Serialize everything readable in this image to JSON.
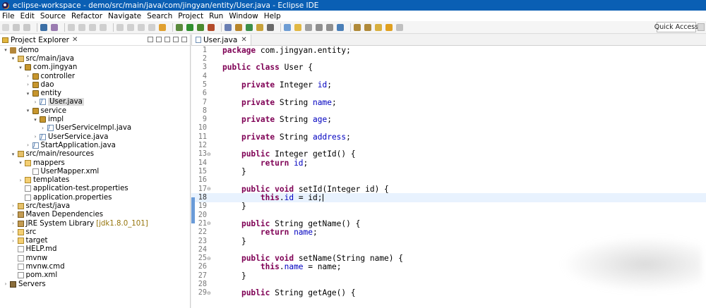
{
  "window": {
    "title": "eclipse-workspace - demo/src/main/java/com/jingyan/entity/User.java - Eclipse IDE"
  },
  "menu": [
    "File",
    "Edit",
    "Source",
    "Refactor",
    "Navigate",
    "Search",
    "Project",
    "Run",
    "Window",
    "Help"
  ],
  "toolbar": {
    "quick_access": "Quick Access",
    "buttons": [
      {
        "icon": "new-icon",
        "color": "#d7d7d7"
      },
      {
        "icon": "save-icon",
        "color": "#c9c9c9"
      },
      {
        "icon": "save-all-icon",
        "color": "#c9c9c9"
      },
      {
        "icon": "terminal-icon",
        "color": "#3b6ea5"
      },
      {
        "icon": "skip-icon",
        "color": "#9a7bb0"
      },
      {
        "icon": "resume-icon",
        "color": "#cfcfcf"
      },
      {
        "icon": "suspend-icon",
        "color": "#cfcfcf"
      },
      {
        "icon": "terminate-icon",
        "color": "#cfcfcf"
      },
      {
        "icon": "disconnect-icon",
        "color": "#cfcfcf"
      },
      {
        "icon": "step-into-icon",
        "color": "#d0d0d0"
      },
      {
        "icon": "step-over-icon",
        "color": "#d0d0d0"
      },
      {
        "icon": "step-return-icon",
        "color": "#d0d0d0"
      },
      {
        "icon": "drop-frame-icon",
        "color": "#d0d0d0"
      },
      {
        "icon": "use-step-filters-icon",
        "color": "#e0a030"
      },
      {
        "icon": "debug-icon",
        "color": "#5a8a3c"
      },
      {
        "icon": "run-icon",
        "color": "#2f8f2f"
      },
      {
        "icon": "coverage-icon",
        "color": "#4b8a2f"
      },
      {
        "icon": "external-tools-icon",
        "color": "#b34b2a"
      },
      {
        "icon": "new-java-project-icon",
        "color": "#6b7fb3"
      },
      {
        "icon": "new-package-icon",
        "color": "#b8862b"
      },
      {
        "icon": "new-class-icon",
        "color": "#3c8f4a"
      },
      {
        "icon": "open-type-icon",
        "color": "#c8a23a"
      },
      {
        "icon": "search-icon",
        "color": "#6a6a6a"
      },
      {
        "icon": "annotation-icon",
        "color": "#6e9dd4"
      },
      {
        "icon": "mark-occurrences-icon",
        "color": "#e1b844"
      },
      {
        "icon": "block-selection-icon",
        "color": "#a0a0a0"
      },
      {
        "icon": "show-whitespace-icon",
        "color": "#8f8f8f"
      },
      {
        "icon": "pilcrow-icon",
        "color": "#8f8f8f"
      },
      {
        "icon": "globe-icon",
        "color": "#4a7fb8"
      },
      {
        "icon": "next-annotation-icon",
        "color": "#b08a3a"
      },
      {
        "icon": "prev-annotation-icon",
        "color": "#b08a3a"
      },
      {
        "icon": "last-edit-icon",
        "color": "#d8b040"
      },
      {
        "icon": "back-icon",
        "color": "#e0a020"
      },
      {
        "icon": "forward-icon",
        "color": "#c0c0c0"
      }
    ]
  },
  "explorer": {
    "title": "Project Explorer",
    "close_glyph": "✕",
    "tree": [
      {
        "label": "demo",
        "depth": 0,
        "state": "expanded",
        "icon": "project-icon"
      },
      {
        "label": "src/main/java",
        "depth": 1,
        "state": "expanded",
        "icon": "source-folder-icon"
      },
      {
        "label": "com.jingyan",
        "depth": 2,
        "state": "expanded",
        "icon": "package-icon"
      },
      {
        "label": "controller",
        "depth": 3,
        "state": "collapsed",
        "icon": "package-icon"
      },
      {
        "label": "dao",
        "depth": 3,
        "state": "collapsed",
        "icon": "package-icon"
      },
      {
        "label": "entity",
        "depth": 3,
        "state": "expanded",
        "icon": "package-icon"
      },
      {
        "label": "User.java",
        "depth": 4,
        "state": "collapsed",
        "icon": "java-file-icon",
        "selected": true
      },
      {
        "label": "service",
        "depth": 3,
        "state": "expanded",
        "icon": "package-icon"
      },
      {
        "label": "impl",
        "depth": 4,
        "state": "expanded",
        "icon": "package-icon"
      },
      {
        "label": "UserServiceImpl.java",
        "depth": 5,
        "state": "collapsed",
        "icon": "java-file-icon"
      },
      {
        "label": "UserService.java",
        "depth": 4,
        "state": "collapsed",
        "icon": "java-file-icon"
      },
      {
        "label": "StartApplication.java",
        "depth": 3,
        "state": "collapsed",
        "icon": "java-file-icon"
      },
      {
        "label": "src/main/resources",
        "depth": 1,
        "state": "expanded",
        "icon": "source-folder-icon"
      },
      {
        "label": "mappers",
        "depth": 2,
        "state": "expanded",
        "icon": "folder-icon"
      },
      {
        "label": "UserMapper.xml",
        "depth": 3,
        "state": "none",
        "icon": "xml-file-icon"
      },
      {
        "label": "templates",
        "depth": 2,
        "state": "collapsed",
        "icon": "folder-icon"
      },
      {
        "label": "application-test.properties",
        "depth": 2,
        "state": "none",
        "icon": "properties-file-icon"
      },
      {
        "label": "application.properties",
        "depth": 2,
        "state": "none",
        "icon": "properties-file-icon"
      },
      {
        "label": "src/test/java",
        "depth": 1,
        "state": "collapsed",
        "icon": "source-folder-icon"
      },
      {
        "label": "Maven Dependencies",
        "depth": 1,
        "state": "collapsed",
        "icon": "library-icon"
      },
      {
        "label": "JRE System Library",
        "depth": 1,
        "state": "collapsed",
        "icon": "library-icon",
        "decoration": "[jdk1.8.0_101]"
      },
      {
        "label": "src",
        "depth": 1,
        "state": "collapsed",
        "icon": "folder-icon"
      },
      {
        "label": "target",
        "depth": 1,
        "state": "collapsed",
        "icon": "folder-icon"
      },
      {
        "label": "HELP.md",
        "depth": 1,
        "state": "none",
        "icon": "text-file-icon"
      },
      {
        "label": "mvnw",
        "depth": 1,
        "state": "none",
        "icon": "text-file-icon"
      },
      {
        "label": "mvnw.cmd",
        "depth": 1,
        "state": "none",
        "icon": "text-file-icon"
      },
      {
        "label": "pom.xml",
        "depth": 1,
        "state": "none",
        "icon": "xml-file-icon"
      },
      {
        "label": "Servers",
        "depth": 0,
        "state": "collapsed",
        "icon": "servers-icon"
      }
    ]
  },
  "editor": {
    "tab_label": "User.java",
    "close_glyph": "✕",
    "current_line": 18,
    "lines": [
      {
        "n": "1",
        "fold": "",
        "tokens": [
          {
            "t": "package",
            "k": "kw"
          },
          {
            "t": " com.jingyan.entity;"
          }
        ]
      },
      {
        "n": "2",
        "fold": "",
        "tokens": []
      },
      {
        "n": "3",
        "fold": "",
        "tokens": [
          {
            "t": "public",
            "k": "kw"
          },
          {
            "t": " "
          },
          {
            "t": "class",
            "k": "kw"
          },
          {
            "t": " User {"
          }
        ]
      },
      {
        "n": "4",
        "fold": "",
        "tokens": []
      },
      {
        "n": "5",
        "fold": "",
        "tokens": [
          {
            "t": "    "
          },
          {
            "t": "private",
            "k": "kw"
          },
          {
            "t": " Integer "
          },
          {
            "t": "id",
            "k": "fd"
          },
          {
            "t": ";"
          }
        ]
      },
      {
        "n": "6",
        "fold": "",
        "tokens": []
      },
      {
        "n": "7",
        "fold": "",
        "tokens": [
          {
            "t": "    "
          },
          {
            "t": "private",
            "k": "kw"
          },
          {
            "t": " String "
          },
          {
            "t": "name",
            "k": "fd"
          },
          {
            "t": ";"
          }
        ]
      },
      {
        "n": "8",
        "fold": "",
        "tokens": []
      },
      {
        "n": "9",
        "fold": "",
        "tokens": [
          {
            "t": "    "
          },
          {
            "t": "private",
            "k": "kw"
          },
          {
            "t": " String "
          },
          {
            "t": "age",
            "k": "fd"
          },
          {
            "t": ";"
          }
        ]
      },
      {
        "n": "10",
        "fold": "",
        "tokens": []
      },
      {
        "n": "11",
        "fold": "",
        "tokens": [
          {
            "t": "    "
          },
          {
            "t": "private",
            "k": "kw"
          },
          {
            "t": " String "
          },
          {
            "t": "address",
            "k": "fd"
          },
          {
            "t": ";"
          }
        ]
      },
      {
        "n": "12",
        "fold": "",
        "tokens": []
      },
      {
        "n": "13",
        "fold": "⊖",
        "tokens": [
          {
            "t": "    "
          },
          {
            "t": "public",
            "k": "kw"
          },
          {
            "t": " Integer getId() {"
          }
        ]
      },
      {
        "n": "14",
        "fold": "",
        "tokens": [
          {
            "t": "        "
          },
          {
            "t": "return",
            "k": "kw"
          },
          {
            "t": " "
          },
          {
            "t": "id",
            "k": "fd"
          },
          {
            "t": ";"
          }
        ]
      },
      {
        "n": "15",
        "fold": "",
        "tokens": [
          {
            "t": "    }"
          }
        ]
      },
      {
        "n": "16",
        "fold": "",
        "tokens": []
      },
      {
        "n": "17",
        "fold": "⊖",
        "tokens": [
          {
            "t": "    "
          },
          {
            "t": "public",
            "k": "kw"
          },
          {
            "t": " "
          },
          {
            "t": "void",
            "k": "kw"
          },
          {
            "t": " setId(Integer id) {"
          }
        ]
      },
      {
        "n": "18",
        "fold": "",
        "tokens": [
          {
            "t": "        "
          },
          {
            "t": "this",
            "k": "kw"
          },
          {
            "t": "."
          },
          {
            "t": "id",
            "k": "fd"
          },
          {
            "t": " = id;"
          }
        ],
        "caret": true
      },
      {
        "n": "19",
        "fold": "",
        "tokens": [
          {
            "t": "    }"
          }
        ]
      },
      {
        "n": "20",
        "fold": "",
        "tokens": []
      },
      {
        "n": "21",
        "fold": "⊖",
        "tokens": [
          {
            "t": "    "
          },
          {
            "t": "public",
            "k": "kw"
          },
          {
            "t": " String getName() {"
          }
        ]
      },
      {
        "n": "22",
        "fold": "",
        "tokens": [
          {
            "t": "        "
          },
          {
            "t": "return",
            "k": "kw"
          },
          {
            "t": " "
          },
          {
            "t": "name",
            "k": "fd"
          },
          {
            "t": ";"
          }
        ]
      },
      {
        "n": "23",
        "fold": "",
        "tokens": [
          {
            "t": "    }"
          }
        ]
      },
      {
        "n": "24",
        "fold": "",
        "tokens": []
      },
      {
        "n": "25",
        "fold": "⊖",
        "tokens": [
          {
            "t": "    "
          },
          {
            "t": "public",
            "k": "kw"
          },
          {
            "t": " "
          },
          {
            "t": "void",
            "k": "kw"
          },
          {
            "t": " setName(String name) {"
          }
        ]
      },
      {
        "n": "26",
        "fold": "",
        "tokens": [
          {
            "t": "        "
          },
          {
            "t": "this",
            "k": "kw"
          },
          {
            "t": "."
          },
          {
            "t": "name",
            "k": "fd"
          },
          {
            "t": " = name;"
          }
        ]
      },
      {
        "n": "27",
        "fold": "",
        "tokens": [
          {
            "t": "    }"
          }
        ]
      },
      {
        "n": "28",
        "fold": "",
        "tokens": []
      },
      {
        "n": "29",
        "fold": "⊖",
        "tokens": [
          {
            "t": "    "
          },
          {
            "t": "public",
            "k": "kw"
          },
          {
            "t": " String getAge() {"
          }
        ]
      }
    ]
  }
}
